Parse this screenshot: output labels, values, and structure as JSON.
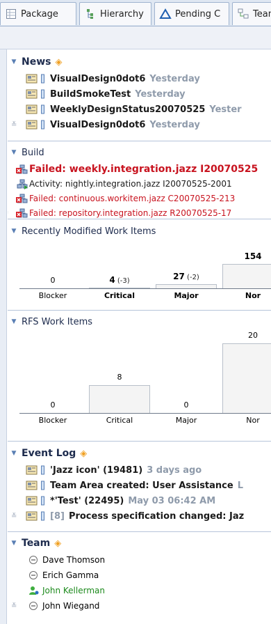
{
  "tabs": [
    {
      "label": "Package",
      "icon": "package-icon"
    },
    {
      "label": "Hierarchy",
      "icon": "hierarchy-icon"
    },
    {
      "label": "Pending C",
      "icon": "pending-changes-icon"
    },
    {
      "label": "Team",
      "icon": "team-icon"
    }
  ],
  "news": {
    "title": "News",
    "items": [
      {
        "title": "VisualDesign0dot6",
        "date": "Yesterday"
      },
      {
        "title": "BuildSmokeTest",
        "date": "Yesterday"
      },
      {
        "title": "WeeklyDesignStatus20070525",
        "date": "Yester"
      },
      {
        "title": "VisualDesign0dot6",
        "date": "Yesterday"
      }
    ]
  },
  "build": {
    "title": "Build",
    "items": [
      {
        "text": "Failed: weekly.integration.jazz I20070525",
        "status": "failed"
      },
      {
        "text": "Activity: nightly.integration.jazz I20070525-2001",
        "status": "activity"
      },
      {
        "text": "Failed: continuous.workitem.jazz C20070525-213",
        "status": "failed"
      },
      {
        "text": "Failed: repository.integration.jazz R20070525-17",
        "status": "failed"
      }
    ]
  },
  "recent_title": "Recently Modified Work Items",
  "rfs_title": "RFS Work Items",
  "chart_data": [
    {
      "type": "bar",
      "title": "Recently Modified Work Items",
      "categories": [
        "Blocker",
        "Critical",
        "Major",
        "Nor"
      ],
      "values": [
        0,
        4,
        27,
        154
      ],
      "value_labels": [
        "0",
        "4",
        "27",
        "154"
      ],
      "deltas": [
        "",
        "(-3)",
        "(-2)",
        ""
      ],
      "bold_categories": [
        false,
        true,
        true,
        true
      ],
      "ylim": [
        0,
        154
      ]
    },
    {
      "type": "bar",
      "title": "RFS Work Items",
      "categories": [
        "Blocker",
        "Critical",
        "Major",
        "Nor"
      ],
      "values": [
        0,
        8,
        0,
        20
      ],
      "value_labels": [
        "0",
        "8",
        "0",
        "20"
      ],
      "bold_categories": [
        false,
        false,
        false,
        false
      ],
      "ylim": [
        0,
        20
      ]
    }
  ],
  "event_log": {
    "title": "Event Log",
    "items": [
      {
        "prefix": "",
        "title": "'Jazz icon' (19481)",
        "date": "3 days ago"
      },
      {
        "prefix": "",
        "title": "Team Area created: User Assistance",
        "date": "L"
      },
      {
        "prefix": "",
        "title": "*'Test' (22495)",
        "date": "May 03 06:42 AM"
      },
      {
        "prefix": "[8]",
        "title": "Process specification changed: Jaz",
        "date": ""
      }
    ]
  },
  "team": {
    "title": "Team",
    "members": [
      {
        "name": "Dave Thomson",
        "online": false
      },
      {
        "name": "Erich Gamma",
        "online": false
      },
      {
        "name": "John Kellerman",
        "online": true
      },
      {
        "name": "John Wiegand",
        "online": false
      }
    ]
  },
  "colors": {
    "failed": "#c8131f",
    "online": "#1c8a1c",
    "accent": "#f0a022"
  }
}
